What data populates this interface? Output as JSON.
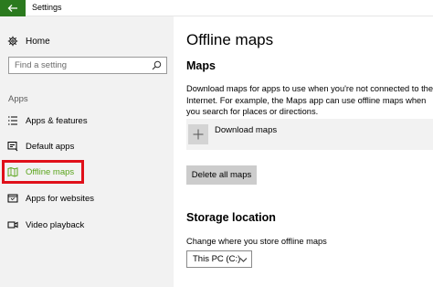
{
  "window": {
    "title": "Settings"
  },
  "sidebar": {
    "home_label": "Home",
    "search_placeholder": "Find a setting",
    "section_label": "Apps",
    "items": [
      {
        "label": "Apps & features",
        "icon": "list-icon"
      },
      {
        "label": "Default apps",
        "icon": "default-apps-icon"
      },
      {
        "label": "Offline maps",
        "icon": "map-icon",
        "selected": true
      },
      {
        "label": "Apps for websites",
        "icon": "web-apps-icon"
      },
      {
        "label": "Video playback",
        "icon": "video-icon"
      }
    ]
  },
  "main": {
    "title": "Offline maps",
    "maps_heading": "Maps",
    "maps_description": "Download maps for apps to use when you're not connected to the Internet. For example, the Maps app can use offline maps when you search for places or directions.",
    "download_label": "Download maps",
    "delete_label": "Delete all maps",
    "storage_heading": "Storage location",
    "storage_description": "Change where you store offline maps",
    "storage_selected": "This PC (C:)"
  },
  "colors": {
    "accent": "#2b7a1f",
    "active_text": "#5aa51c",
    "highlight_border": "#e0101a",
    "sidebar_bg": "#f2f2f2"
  }
}
